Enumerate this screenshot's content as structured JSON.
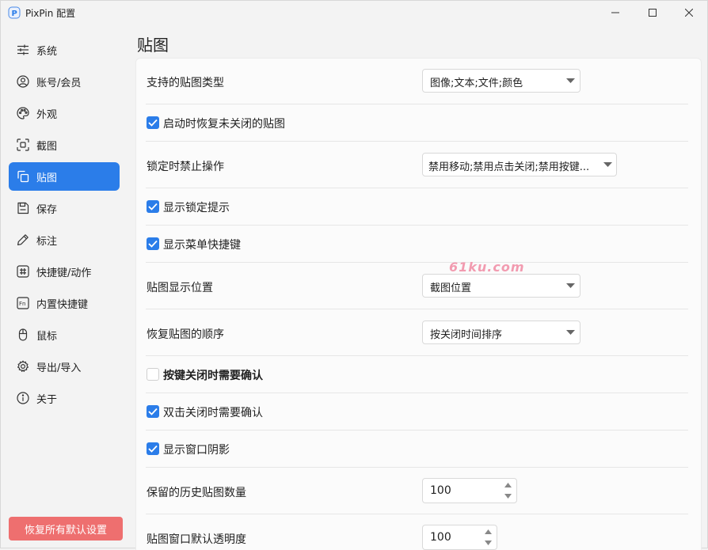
{
  "window": {
    "title": "PixPin 配置"
  },
  "sidebar": {
    "items": [
      {
        "label": "系统",
        "icon": "sliders-icon"
      },
      {
        "label": "账号/会员",
        "icon": "user-icon"
      },
      {
        "label": "外观",
        "icon": "palette-icon"
      },
      {
        "label": "截图",
        "icon": "screenshot-icon"
      },
      {
        "label": "贴图",
        "icon": "pin-copy-icon",
        "active": true
      },
      {
        "label": "保存",
        "icon": "save-icon"
      },
      {
        "label": "标注",
        "icon": "pen-icon"
      },
      {
        "label": "快捷键/动作",
        "icon": "hash-icon"
      },
      {
        "label": "内置快捷键",
        "icon": "fn-key-icon"
      },
      {
        "label": "鼠标",
        "icon": "mouse-icon"
      },
      {
        "label": "导出/导入",
        "icon": "gear-icon"
      },
      {
        "label": "关于",
        "icon": "info-icon"
      }
    ],
    "reset_label": "恢复所有默认设置"
  },
  "page": {
    "title": "贴图"
  },
  "settings": {
    "pin_types": {
      "label": "支持的贴图类型",
      "value": "图像;文本;文件;颜色"
    },
    "restore_on_start": {
      "label": "启动时恢复未关闭的贴图",
      "checked": true
    },
    "lock_disable": {
      "label": "锁定时禁止操作",
      "value": "禁用移动;禁用点击关闭;禁用按键..."
    },
    "show_lock_tip": {
      "label": "显示锁定提示",
      "checked": true
    },
    "show_menu_shortcuts": {
      "label": "显示菜单快捷键",
      "checked": true
    },
    "pin_position": {
      "label": "贴图显示位置",
      "value": "截图位置"
    },
    "restore_order": {
      "label": "恢复贴图的顺序",
      "value": "按关闭时间排序"
    },
    "confirm_key_close": {
      "label": "按键关闭时需要确认",
      "checked": false
    },
    "confirm_dblclick_close": {
      "label": "双击关闭时需要确认",
      "checked": true
    },
    "show_shadow": {
      "label": "显示窗口阴影",
      "checked": true
    },
    "history_count": {
      "label": "保留的历史贴图数量",
      "value": "100"
    },
    "default_opacity": {
      "label": "贴图窗口默认透明度",
      "value": "100"
    }
  },
  "watermark": {
    "text": "61ku.com"
  },
  "colors": {
    "accent": "#2b7de9",
    "reset_button": "#ee6f6f"
  }
}
